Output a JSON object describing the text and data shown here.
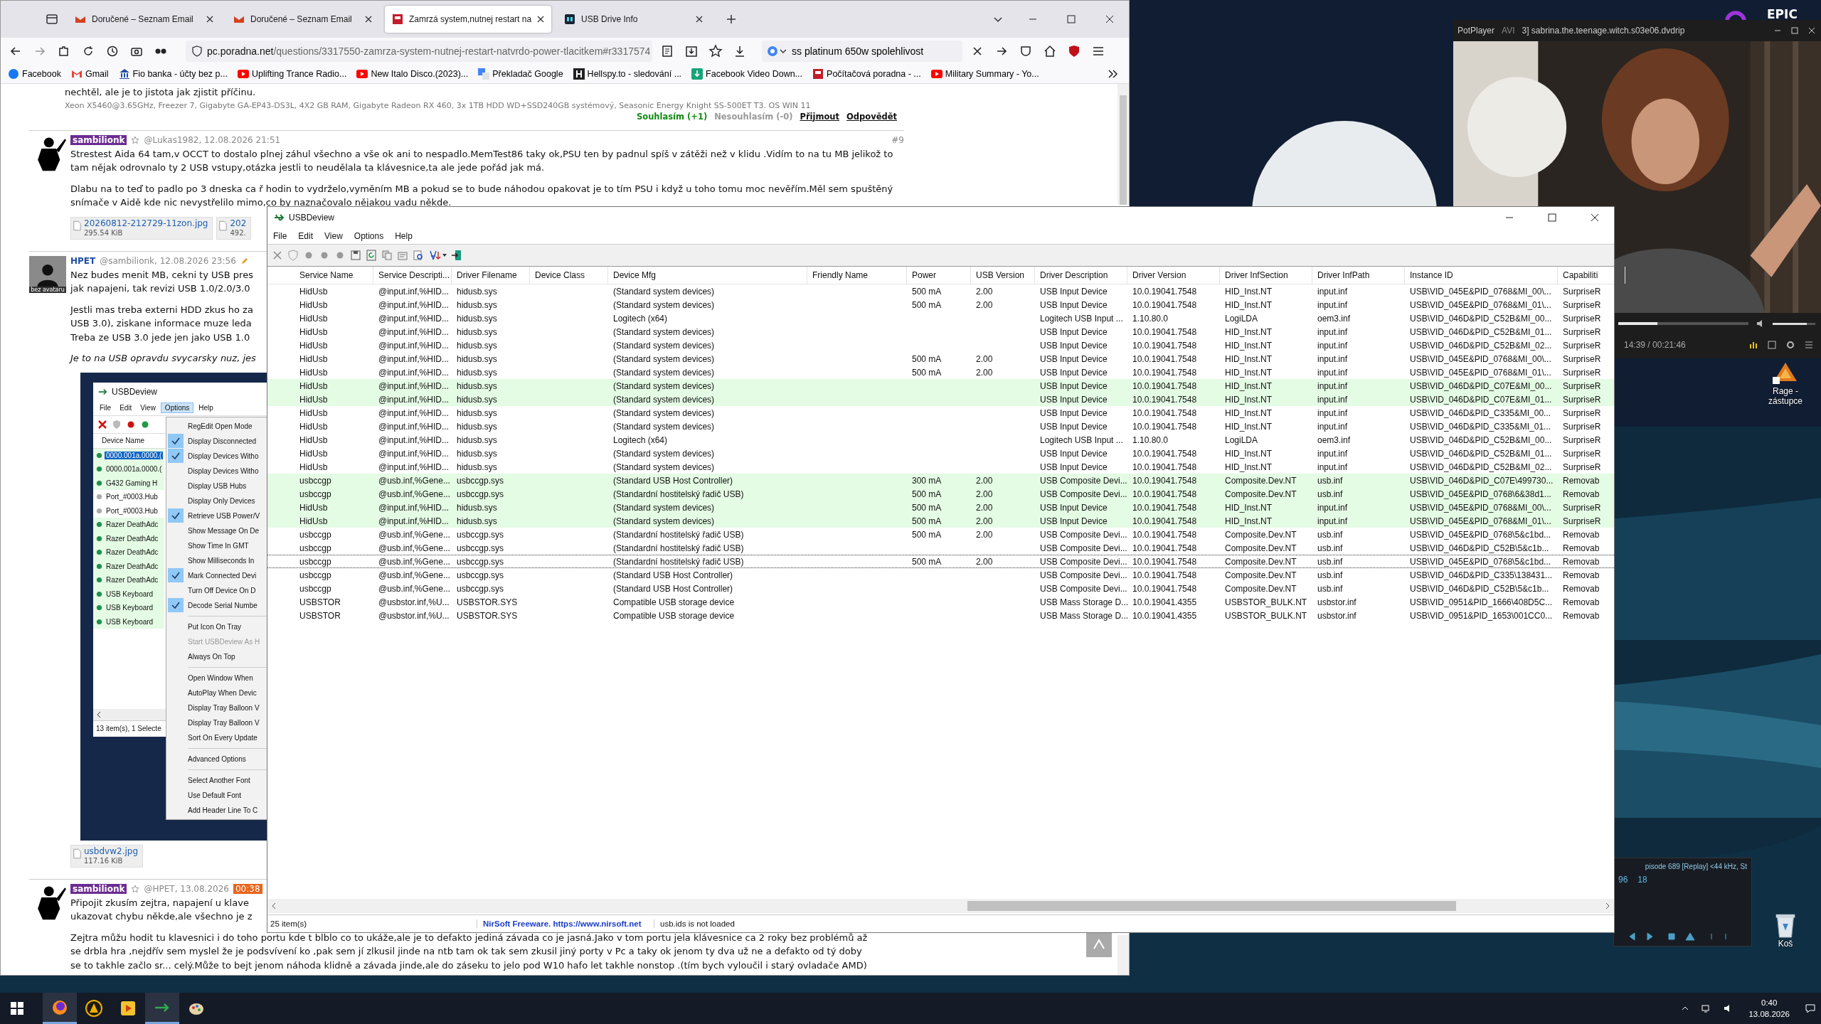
{
  "desktop": {
    "logo": "EPIC",
    "icons": [
      {
        "kind": "shortcut",
        "label": "Rage - zástupce"
      },
      {
        "kind": "bin",
        "label": "Koš"
      }
    ]
  },
  "browser": {
    "tabs": [
      {
        "kind": "mail",
        "title": "Doručené – Seznam Email",
        "selected": false
      },
      {
        "kind": "mail",
        "title": "Doručené – Seznam Email",
        "selected": false
      },
      {
        "kind": "forum",
        "title": "Zamrzá system,nutnej restart na",
        "selected": true
      },
      {
        "kind": "app",
        "title": "USB Drive Info",
        "selected": false
      }
    ],
    "url_host": "pc.poradna.net",
    "url_path": "/questions/3317550-zamrza-system-nutnej-restart-natvrdo-power-tlacitkem#r3317574",
    "search": "ss platinum 650w  spolehlivost",
    "bookmarks": [
      {
        "kind": "circle",
        "label": "Facebook"
      },
      {
        "kind": "mail",
        "label": "Gmail"
      },
      {
        "kind": "bank",
        "label": "Fio banka - účty bez p..."
      },
      {
        "kind": "video",
        "label": "Uplifting Trance Radio..."
      },
      {
        "kind": "video",
        "label": "New Italo Disco.(2023)..."
      },
      {
        "kind": "translate",
        "label": "Překladač Google"
      },
      {
        "kind": "square",
        "label": "Hellspy.to - sledování ..."
      },
      {
        "kind": "download",
        "label": "Facebook Video Down..."
      },
      {
        "kind": "forum",
        "label": "Počítačová poradna - ..."
      },
      {
        "kind": "video",
        "label": "Military Summary - Yo..."
      }
    ]
  },
  "page": {
    "top_post": {
      "text": "nechtěl, ale je to jistota jak zjistit příčinu.",
      "signature": "Xeon X5460@3.65GHz, Freezer 7, Gigabyte GA-EP43-DS3L, 4X2 GB RAM, Gigabyte Radeon RX 460, 3x 1TB HDD WD+SSD240GB systémový, Seasonic Energy Knight SS-500ET T3. OS WIN 11",
      "agree": "Souhlasím (+1)",
      "disagree": "Nesouhlasím (-0)",
      "accept": "Přijmout",
      "reply": "Odpovědět"
    },
    "posts": [
      {
        "avatar": {
          "kind": "figure"
        },
        "author": "sambilionk",
        "highlight": true,
        "meta": "@Lukas1982, 12.08.2026 21:51",
        "number": "#9",
        "paragraphs": [
          {
            "lines": [
              "Strestest Aida 64 tam,v OCCT to dostalo plnej záhul všechno a vše ok ani to nespadlo.MemTest86 taky ok,PSU ten by padnul spíš v zátěži než v klidu .Vidím to na tu MB jelikož to tam nějak odrovnalo ty 2 USB vstupy,otázka jestli to neudělala ta klávesnice,ta ale jede pořád jak má."
            ]
          },
          {
            "lines": [
              "Dlabu na to teď to padlo po 3 dneska ca ř hodin to vydrželo,vyměním MB a pokud se to bude náhodou opakovat je to tím PSU i když u toho tomu moc nevěřím.Měl sem spuštěný snímače v Aidě kde nic nevystřelilo mimo,co by naznačovalo nějakou vadu někde."
            ]
          }
        ],
        "attachments": [
          {
            "name": "20260812-212729-11zon.jpg",
            "size": "295.54 KiB"
          },
          {
            "name": "202",
            "size": "492."
          }
        ]
      },
      {
        "avatar": {
          "kind": "blank",
          "label": "bez avataru"
        },
        "author": "HPET",
        "highlight": false,
        "meta": "@sambilionk, 12.08.2026 23:56",
        "paragraphs": [
          {
            "lines": [
              "Nez budes menit MB, cekni ty USB pres",
              "jak napajeni, tak revizi USB 1.0/2.0/3.0"
            ]
          },
          {
            "lines": [
              "Jestli mas treba externi HDD zkus ho za",
              "USB 3.0), ziskane informace muze leda",
              "Treba ze USB 3.0 jede jen jako USB 1.0"
            ]
          },
          {
            "italic": true,
            "lines": [
              "Je to na USB opravdu svycarsky nuz, jes"
            ]
          }
        ],
        "screenshot": true,
        "attachments": [
          {
            "name": "usbdvw2.jpg",
            "size": "117.16 KiB"
          }
        ]
      },
      {
        "avatar": {
          "kind": "figure"
        },
        "author": "sambilionk",
        "highlight": true,
        "meta": "@HPET, 13.08.2026",
        "time_badge": "00:38",
        "paragraphs": [
          {
            "lines": [
              "Připojit zkusím zejtra, napajení u klave",
              "ukazovat chybu někde,ale všechno je z"
            ]
          },
          {
            "lines": [
              "Zejtra můžu hodit tu klavesnici i do toho portu kde t blblo co to ukáže,ale je to defakto jediná závada co je jasná.Jako v tom portu jela klávesnice ca 2 roky bez problémů až",
              "se drbla hra ,nejdřív sem myslel že je podsvívení ko ,pak sem jí zlkusil jinde na ntb tam ok tak sem zkusil jiný porty v Pc a taky ok jenom ty dva už ne a defakto od tý doby",
              "se to takhle začlo sr... celý.Může to bejt jenom náhoda klidně a závada jinde,ale do záseku to jelo pod W10 hafo let takhle nonstop .(tím bych vyloučil i starý ovladače AMD)"
            ]
          }
        ]
      }
    ]
  },
  "screenshot": {
    "title": "USBDeview",
    "menu": [
      {
        "label": "File",
        "selected": false
      },
      {
        "label": "Edit",
        "selected": false
      },
      {
        "label": "View",
        "selected": false
      },
      {
        "label": "Options",
        "selected": true
      },
      {
        "label": "Help",
        "selected": false
      }
    ],
    "column": "Device Name",
    "devices": [
      {
        "name": "0000.001a.0000.(",
        "connected": true,
        "selected": true
      },
      {
        "name": "0000.001a.0000.(",
        "connected": true,
        "selected": false
      },
      {
        "name": "G432 Gaming H",
        "connected": true,
        "selected": false
      },
      {
        "name": "Port_#0003.Hub",
        "connected": false,
        "selected": false
      },
      {
        "name": "Port_#0003.Hub",
        "connected": false,
        "selected": false
      },
      {
        "name": "Razer DeathAdc",
        "connected": true,
        "selected": false
      },
      {
        "name": "Razer DeathAdc",
        "connected": true,
        "selected": false
      },
      {
        "name": "Razer DeathAdc",
        "connected": true,
        "selected": false
      },
      {
        "name": "Razer DeathAdc",
        "connected": true,
        "selected": false
      },
      {
        "name": "Razer DeathAdc",
        "connected": true,
        "selected": false
      },
      {
        "name": "USB Keyboard",
        "connected": true,
        "selected": false
      },
      {
        "name": "USB Keyboard",
        "connected": true,
        "selected": false
      },
      {
        "name": "USB Keyboard",
        "connected": true,
        "selected": false
      }
    ],
    "status": "13 item(s), 1 Selecte",
    "option_groups": [
      [
        {
          "label": "RegEdit Open Mode",
          "checked": false,
          "disabled": false
        },
        {
          "label": "Display Disconnected",
          "checked": true,
          "disabled": false
        },
        {
          "label": "Display Devices Witho",
          "checked": true,
          "disabled": false
        },
        {
          "label": "Display Devices Witho",
          "checked": false,
          "disabled": false
        },
        {
          "label": "Display USB Hubs",
          "checked": false,
          "disabled": false
        },
        {
          "label": "Display Only Devices",
          "checked": false,
          "disabled": false
        },
        {
          "label": "Retrieve USB Power/V",
          "checked": true,
          "disabled": false
        },
        {
          "label": "Show Message On De",
          "checked": false,
          "disabled": false
        },
        {
          "label": "Show Time In GMT",
          "checked": false,
          "disabled": false
        },
        {
          "label": "Show Milliseconds In",
          "checked": false,
          "disabled": false
        },
        {
          "label": "Mark Connected Devi",
          "checked": true,
          "disabled": false
        },
        {
          "label": "Turn Off Device On D",
          "checked": false,
          "disabled": false
        },
        {
          "label": "Decode Serial Numbe",
          "checked": true,
          "disabled": false
        }
      ],
      [
        {
          "label": "Put Icon On Tray",
          "checked": false,
          "disabled": false
        },
        {
          "label": "Start USBDeview As H",
          "checked": false,
          "disabled": true
        },
        {
          "label": "Always On Top",
          "checked": false,
          "disabled": false
        }
      ],
      [
        {
          "label": "Open Window When",
          "checked": false,
          "disabled": false
        },
        {
          "label": "AutoPlay When Devic",
          "checked": false,
          "disabled": false
        },
        {
          "label": "Display Tray Balloon V",
          "checked": false,
          "disabled": false
        },
        {
          "label": "Display Tray Balloon V",
          "checked": false,
          "disabled": false
        },
        {
          "label": "Sort On Every Update",
          "checked": false,
          "disabled": false
        }
      ],
      [
        {
          "label": "Advanced Options",
          "checked": false,
          "disabled": false
        }
      ],
      [
        {
          "label": "Select Another Font",
          "checked": false,
          "disabled": false
        },
        {
          "label": "Use Default Font",
          "checked": false,
          "disabled": false
        },
        {
          "label": "Add Header Line To C",
          "checked": false,
          "disabled": false
        }
      ]
    ]
  },
  "usbdeview": {
    "title": "USBDeview",
    "menu": [
      "File",
      "Edit",
      "View",
      "Options",
      "Help"
    ],
    "columns": [
      "Service Name",
      "Service Descripti...",
      "Driver Filename",
      "Device Class",
      "Device Mfg",
      "Friendly Name",
      "Power",
      "USB Version",
      "Driver Description",
      "Driver Version",
      "Driver InfSection",
      "Driver InfPath",
      "Instance ID",
      "Capabiliti"
    ],
    "rows": [
      {
        "connected": false,
        "focused": false,
        "service": "HidUsb",
        "description": "@input.inf,%HID...",
        "file": "hidusb.sys",
        "mfg": "(Standard system devices)",
        "power": "500 mA",
        "usb_version": "2.00",
        "driver_desc": "USB Input Device",
        "driver_version": "10.0.19041.7548",
        "inf_section": "HID_Inst.NT",
        "inf_path": "input.inf",
        "instance_id": "USB\\VID_045E&PID_0768&MI_00\\...",
        "capabilities": "SurpriseR"
      },
      {
        "connected": false,
        "focused": false,
        "service": "HidUsb",
        "description": "@input.inf,%HID...",
        "file": "hidusb.sys",
        "mfg": "(Standard system devices)",
        "power": "500 mA",
        "usb_version": "2.00",
        "driver_desc": "USB Input Device",
        "driver_version": "10.0.19041.7548",
        "inf_section": "HID_Inst.NT",
        "inf_path": "input.inf",
        "instance_id": "USB\\VID_045E&PID_0768&MI_01\\...",
        "capabilities": "SurpriseR"
      },
      {
        "connected": false,
        "focused": false,
        "service": "HidUsb",
        "description": "@input.inf,%HID...",
        "file": "hidusb.sys",
        "mfg": "Logitech (x64)",
        "driver_desc": "Logitech USB Input ...",
        "driver_version": "1.10.80.0",
        "inf_section": "LogiLDA",
        "inf_path": "oem3.inf",
        "instance_id": "USB\\VID_046D&PID_C52B&MI_00...",
        "capabilities": "SurpriseR"
      },
      {
        "connected": false,
        "focused": false,
        "service": "HidUsb",
        "description": "@input.inf,%HID...",
        "file": "hidusb.sys",
        "mfg": "(Standard system devices)",
        "driver_desc": "USB Input Device",
        "driver_version": "10.0.19041.7548",
        "inf_section": "HID_Inst.NT",
        "inf_path": "input.inf",
        "instance_id": "USB\\VID_046D&PID_C52B&MI_01...",
        "capabilities": "SurpriseR"
      },
      {
        "connected": false,
        "focused": false,
        "service": "HidUsb",
        "description": "@input.inf,%HID...",
        "file": "hidusb.sys",
        "mfg": "(Standard system devices)",
        "driver_desc": "USB Input Device",
        "driver_version": "10.0.19041.7548",
        "inf_section": "HID_Inst.NT",
        "inf_path": "input.inf",
        "instance_id": "USB\\VID_046D&PID_C52B&MI_02...",
        "capabilities": "SurpriseR"
      },
      {
        "connected": false,
        "focused": false,
        "service": "HidUsb",
        "description": "@input.inf,%HID...",
        "file": "hidusb.sys",
        "mfg": "(Standard system devices)",
        "power": "500 mA",
        "usb_version": "2.00",
        "driver_desc": "USB Input Device",
        "driver_version": "10.0.19041.7548",
        "inf_section": "HID_Inst.NT",
        "inf_path": "input.inf",
        "instance_id": "USB\\VID_045E&PID_0768&MI_00\\...",
        "capabilities": "SurpriseR"
      },
      {
        "connected": false,
        "focused": false,
        "service": "HidUsb",
        "description": "@input.inf,%HID...",
        "file": "hidusb.sys",
        "mfg": "(Standard system devices)",
        "power": "500 mA",
        "usb_version": "2.00",
        "driver_desc": "USB Input Device",
        "driver_version": "10.0.19041.7548",
        "inf_section": "HID_Inst.NT",
        "inf_path": "input.inf",
        "instance_id": "USB\\VID_045E&PID_0768&MI_01\\...",
        "capabilities": "SurpriseR"
      },
      {
        "connected": true,
        "focused": false,
        "service": "HidUsb",
        "description": "@input.inf,%HID...",
        "file": "hidusb.sys",
        "mfg": "(Standard system devices)",
        "driver_desc": "USB Input Device",
        "driver_version": "10.0.19041.7548",
        "inf_section": "HID_Inst.NT",
        "inf_path": "input.inf",
        "instance_id": "USB\\VID_046D&PID_C07E&MI_00...",
        "capabilities": "SurpriseR"
      },
      {
        "connected": true,
        "focused": false,
        "service": "HidUsb",
        "description": "@input.inf,%HID...",
        "file": "hidusb.sys",
        "mfg": "(Standard system devices)",
        "driver_desc": "USB Input Device",
        "driver_version": "10.0.19041.7548",
        "inf_section": "HID_Inst.NT",
        "inf_path": "input.inf",
        "instance_id": "USB\\VID_046D&PID_C07E&MI_01...",
        "capabilities": "SurpriseR"
      },
      {
        "connected": false,
        "focused": false,
        "service": "HidUsb",
        "description": "@input.inf,%HID...",
        "file": "hidusb.sys",
        "mfg": "(Standard system devices)",
        "driver_desc": "USB Input Device",
        "driver_version": "10.0.19041.7548",
        "inf_section": "HID_Inst.NT",
        "inf_path": "input.inf",
        "instance_id": "USB\\VID_046D&PID_C335&MI_00...",
        "capabilities": "SurpriseR"
      },
      {
        "connected": false,
        "focused": false,
        "service": "HidUsb",
        "description": "@input.inf,%HID...",
        "file": "hidusb.sys",
        "mfg": "(Standard system devices)",
        "driver_desc": "USB Input Device",
        "driver_version": "10.0.19041.7548",
        "inf_section": "HID_Inst.NT",
        "inf_path": "input.inf",
        "instance_id": "USB\\VID_046D&PID_C335&MI_01...",
        "capabilities": "SurpriseR"
      },
      {
        "connected": false,
        "focused": false,
        "service": "HidUsb",
        "description": "@input.inf,%HID...",
        "file": "hidusb.sys",
        "mfg": "Logitech (x64)",
        "driver_desc": "Logitech USB Input ...",
        "driver_version": "1.10.80.0",
        "inf_section": "LogiLDA",
        "inf_path": "oem3.inf",
        "instance_id": "USB\\VID_046D&PID_C52B&MI_00...",
        "capabilities": "SurpriseR"
      },
      {
        "connected": false,
        "focused": false,
        "service": "HidUsb",
        "description": "@input.inf,%HID...",
        "file": "hidusb.sys",
        "mfg": "(Standard system devices)",
        "driver_desc": "USB Input Device",
        "driver_version": "10.0.19041.7548",
        "inf_section": "HID_Inst.NT",
        "inf_path": "input.inf",
        "instance_id": "USB\\VID_046D&PID_C52B&MI_01...",
        "capabilities": "SurpriseR"
      },
      {
        "connected": false,
        "focused": false,
        "service": "HidUsb",
        "description": "@input.inf,%HID...",
        "file": "hidusb.sys",
        "mfg": "(Standard system devices)",
        "driver_desc": "USB Input Device",
        "driver_version": "10.0.19041.7548",
        "inf_section": "HID_Inst.NT",
        "inf_path": "input.inf",
        "instance_id": "USB\\VID_046D&PID_C52B&MI_02...",
        "capabilities": "SurpriseR"
      },
      {
        "connected": true,
        "focused": false,
        "service": "usbccgp",
        "description": "@usb.inf,%Gene...",
        "file": "usbccgp.sys",
        "mfg": "(Standard USB Host Controller)",
        "power": "300 mA",
        "usb_version": "2.00",
        "driver_desc": "USB Composite Devi...",
        "driver_version": "10.0.19041.7548",
        "inf_section": "Composite.Dev.NT",
        "inf_path": "usb.inf",
        "instance_id": "USB\\VID_046D&PID_C07E\\499730...",
        "capabilities": "Removab"
      },
      {
        "connected": true,
        "focused": false,
        "service": "usbccgp",
        "description": "@usb.inf,%Gene...",
        "file": "usbccgp.sys",
        "mfg": "(Standardní hostitelský řadič USB)",
        "power": "500 mA",
        "usb_version": "2.00",
        "driver_desc": "USB Composite Devi...",
        "driver_version": "10.0.19041.7548",
        "inf_section": "Composite.Dev.NT",
        "inf_path": "usb.inf",
        "instance_id": "USB\\VID_045E&PID_0768\\6&38d1...",
        "capabilities": "Removab"
      },
      {
        "connected": true,
        "focused": false,
        "service": "HidUsb",
        "description": "@input.inf,%HID...",
        "file": "hidusb.sys",
        "mfg": "(Standard system devices)",
        "power": "500 mA",
        "usb_version": "2.00",
        "driver_desc": "USB Input Device",
        "driver_version": "10.0.19041.7548",
        "inf_section": "HID_Inst.NT",
        "inf_path": "input.inf",
        "instance_id": "USB\\VID_045E&PID_0768&MI_00\\...",
        "capabilities": "SurpriseR"
      },
      {
        "connected": true,
        "focused": false,
        "service": "HidUsb",
        "description": "@input.inf,%HID...",
        "file": "hidusb.sys",
        "mfg": "(Standard system devices)",
        "power": "500 mA",
        "usb_version": "2.00",
        "driver_desc": "USB Input Device",
        "driver_version": "10.0.19041.7548",
        "inf_section": "HID_Inst.NT",
        "inf_path": "input.inf",
        "instance_id": "USB\\VID_045E&PID_0768&MI_01\\...",
        "capabilities": "SurpriseR"
      },
      {
        "connected": false,
        "focused": false,
        "service": "usbccgp",
        "description": "@usb.inf,%Gene...",
        "file": "usbccgp.sys",
        "mfg": "(Standardní hostitelský řadič USB)",
        "power": "500 mA",
        "usb_version": "2.00",
        "driver_desc": "USB Composite Devi...",
        "driver_version": "10.0.19041.7548",
        "inf_section": "Composite.Dev.NT",
        "inf_path": "usb.inf",
        "instance_id": "USB\\VID_045E&PID_0768\\5&c1bd...",
        "capabilities": "Removab"
      },
      {
        "connected": false,
        "focused": false,
        "service": "usbccgp",
        "description": "@usb.inf,%Gene...",
        "file": "usbccgp.sys",
        "mfg": "(Standardní hostitelský řadič USB)",
        "driver_desc": "USB Composite Devi...",
        "driver_version": "10.0.19041.7548",
        "inf_section": "Composite.Dev.NT",
        "inf_path": "usb.inf",
        "instance_id": "USB\\VID_046D&PID_C52B\\5&c1b...",
        "capabilities": "Removab"
      },
      {
        "connected": false,
        "focused": true,
        "service": "usbccgp",
        "description": "@usb.inf,%Gene...",
        "file": "usbccgp.sys",
        "mfg": "(Standardní hostitelský řadič USB)",
        "power": "500 mA",
        "usb_version": "2.00",
        "driver_desc": "USB Composite Devi...",
        "driver_version": "10.0.19041.7548",
        "inf_section": "Composite.Dev.NT",
        "inf_path": "usb.inf",
        "instance_id": "USB\\VID_045E&PID_0768\\5&c1bd...",
        "capabilities": "Removab"
      },
      {
        "connected": false,
        "focused": false,
        "service": "usbccgp",
        "description": "@usb.inf,%Gene...",
        "file": "usbccgp.sys",
        "mfg": "(Standard USB Host Controller)",
        "driver_desc": "USB Composite Devi...",
        "driver_version": "10.0.19041.7548",
        "inf_section": "Composite.Dev.NT",
        "inf_path": "usb.inf",
        "instance_id": "USB\\VID_046D&PID_C335\\138431...",
        "capabilities": "Removab"
      },
      {
        "connected": false,
        "focused": false,
        "service": "usbccgp",
        "description": "@usb.inf,%Gene...",
        "file": "usbccgp.sys",
        "mfg": "(Standard USB Host Controller)",
        "driver_desc": "USB Composite Devi...",
        "driver_version": "10.0.19041.7548",
        "inf_section": "Composite.Dev.NT",
        "inf_path": "usb.inf",
        "instance_id": "USB\\VID_046D&PID_C52B\\5&c1b...",
        "capabilities": "Removab"
      },
      {
        "connected": false,
        "focused": false,
        "service": "USBSTOR",
        "description": "@usbstor.inf,%U...",
        "file": "USBSTOR.SYS",
        "mfg": "Compatible USB storage device",
        "driver_desc": "USB Mass Storage D...",
        "driver_version": "10.0.19041.4355",
        "inf_section": "USBSTOR_BULK.NT",
        "inf_path": "usbstor.inf",
        "instance_id": "USB\\VID_0951&PID_1666\\408D5C...",
        "capabilities": "Removab"
      },
      {
        "connected": false,
        "focused": false,
        "service": "USBSTOR",
        "description": "@usbstor.inf,%U...",
        "file": "USBSTOR.SYS",
        "mfg": "Compatible USB storage device",
        "driver_desc": "USB Mass Storage D...",
        "driver_version": "10.0.19041.4355",
        "inf_section": "USBSTOR_BULK.NT",
        "inf_path": "usbstor.inf",
        "instance_id": "USB\\VID_0951&PID_1653\\001CC0...",
        "capabilities": "Removab"
      }
    ],
    "status": {
      "count": "25 item(s)",
      "credit": "NirSoft Freeware.  https://www.nirsoft.net",
      "ids": "usb.ids is not loaded"
    }
  },
  "player": {
    "app": "PotPlayer",
    "format": "AVI",
    "title": "3] sabrina.the.teenage.witch.s03e06.dvdrip",
    "time": "14:39 / 00:21:46",
    "seek": {
      "level": 0.3
    },
    "volume": {
      "level": 0.8
    }
  },
  "mini_player": {
    "track": "pisode 689 [Replay] <44 kHz, St",
    "bitrate": "96",
    "rate": "18"
  },
  "taskbar": {
    "apps": [
      {
        "kind": "round",
        "running": true
      },
      {
        "kind": "triangle",
        "running": false
      },
      {
        "kind": "player",
        "running": false
      },
      {
        "kind": "usb",
        "running": true
      },
      {
        "kind": "palette",
        "running": false
      }
    ],
    "time": "0:40",
    "date": "13.08.2026"
  }
}
